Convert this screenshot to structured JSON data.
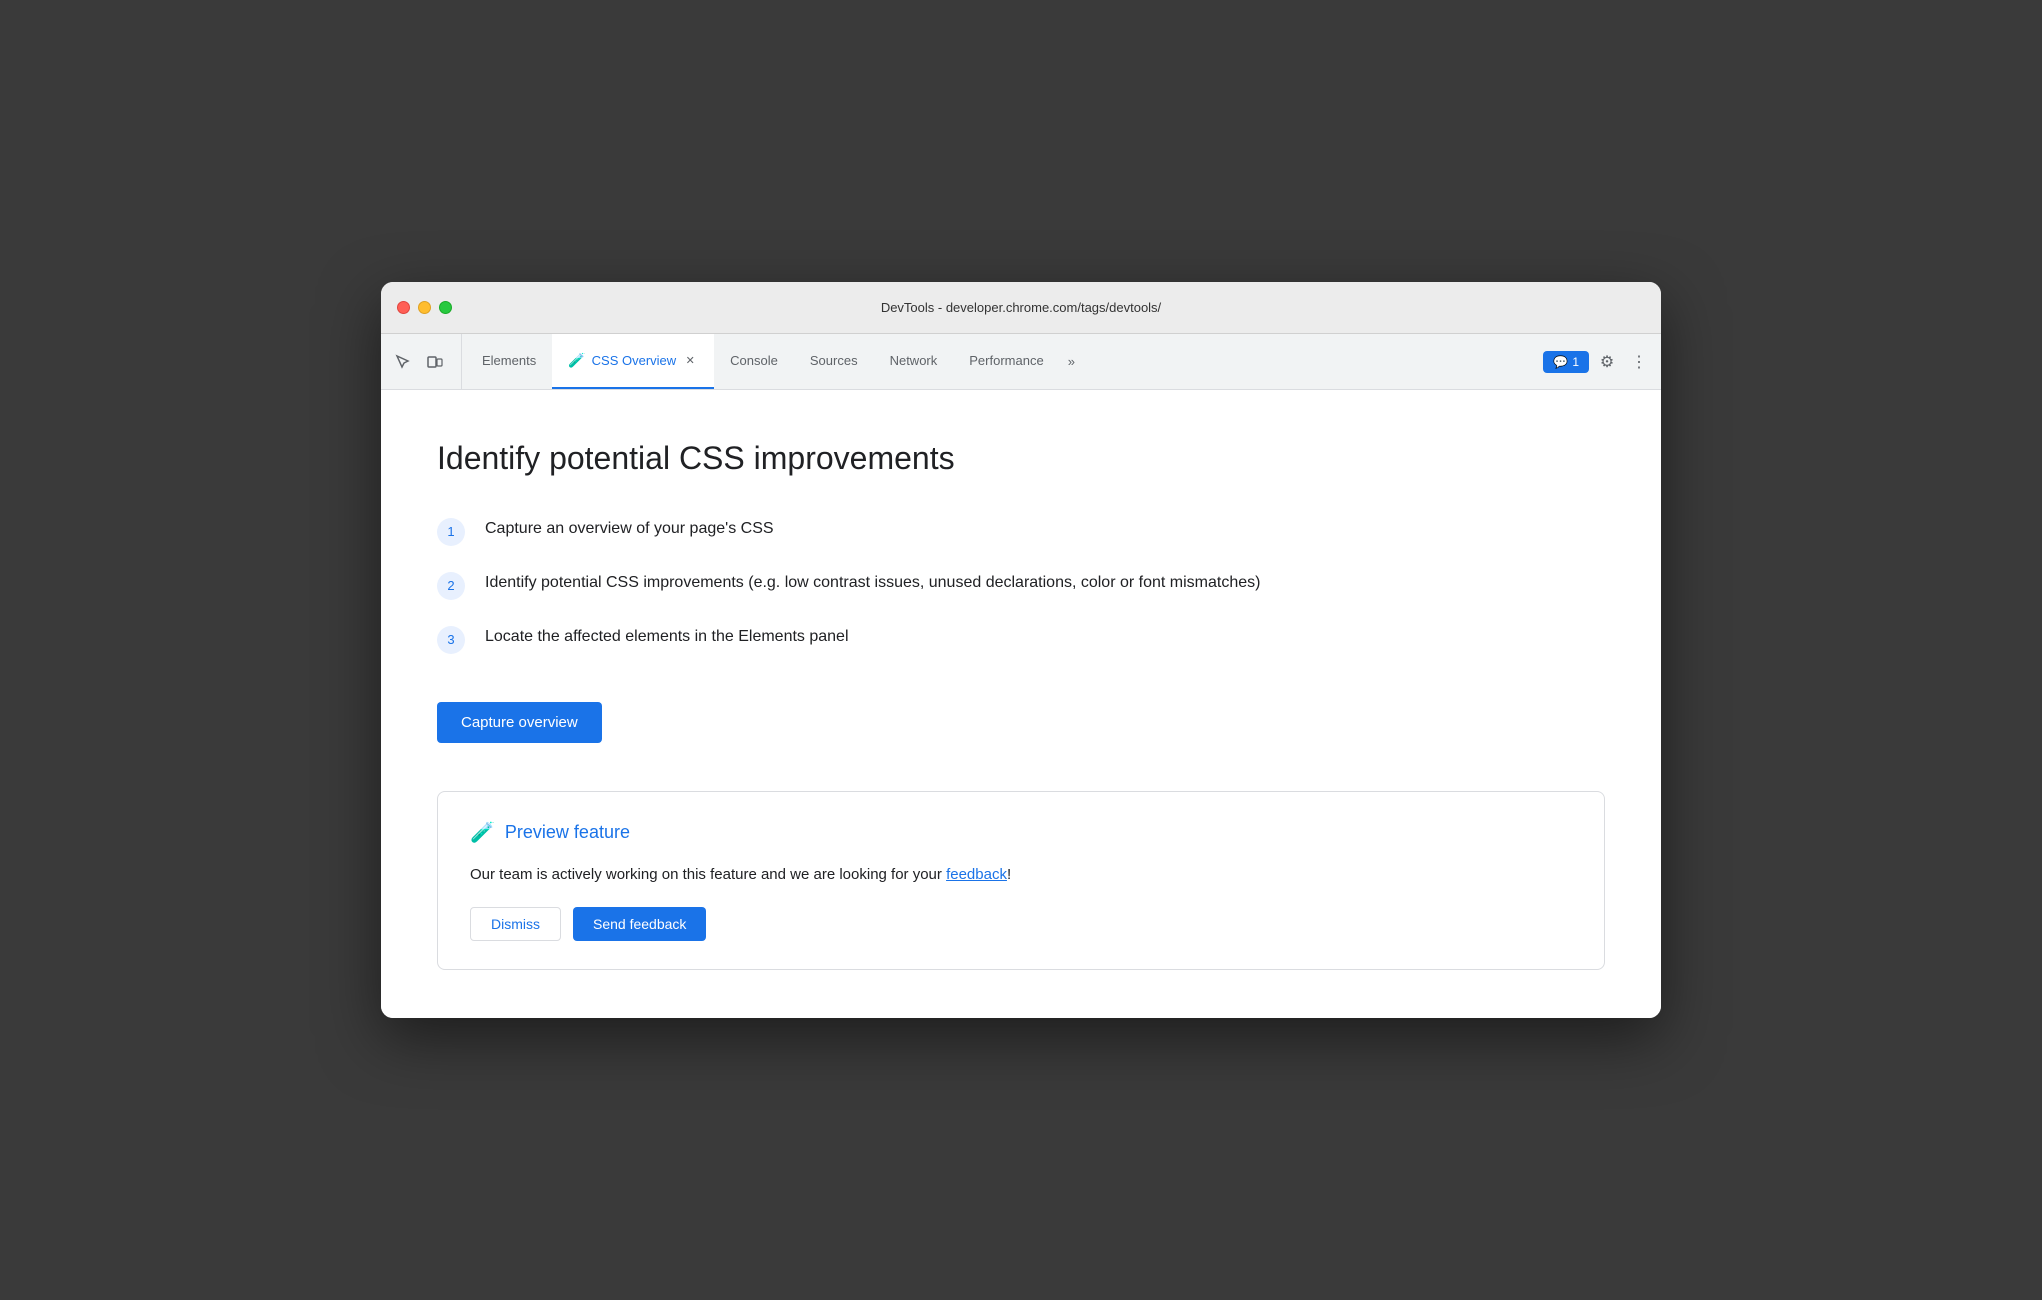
{
  "window": {
    "title": "DevTools - developer.chrome.com/tags/devtools/"
  },
  "tabs": [
    {
      "id": "elements",
      "label": "Elements",
      "active": false
    },
    {
      "id": "css-overview",
      "label": "CSS Overview",
      "active": true,
      "hasFlask": true,
      "hasClose": true
    },
    {
      "id": "console",
      "label": "Console",
      "active": false
    },
    {
      "id": "sources",
      "label": "Sources",
      "active": false
    },
    {
      "id": "network",
      "label": "Network",
      "active": false
    },
    {
      "id": "performance",
      "label": "Performance",
      "active": false
    }
  ],
  "toolbar": {
    "more_tabs_label": "»",
    "notification_count": "1",
    "notification_icon": "💬"
  },
  "main": {
    "page_title": "Identify potential CSS improvements",
    "steps": [
      {
        "number": "1",
        "text": "Capture an overview of your page's CSS"
      },
      {
        "number": "2",
        "text": "Identify potential CSS improvements (e.g. low contrast issues, unused declarations, color or font mismatches)"
      },
      {
        "number": "3",
        "text": "Locate the affected elements in the Elements panel"
      }
    ],
    "capture_button_label": "Capture overview",
    "preview": {
      "icon": "🧪",
      "title": "Preview feature",
      "text_before": "Our team is actively working on this feature and we are looking for your ",
      "feedback_link_text": "feedback",
      "text_after": "!"
    }
  },
  "colors": {
    "blue": "#1a73e8",
    "light_blue_bg": "#e8f0fe",
    "text_primary": "#202124",
    "text_secondary": "#5f6368",
    "border": "#dadce0"
  }
}
